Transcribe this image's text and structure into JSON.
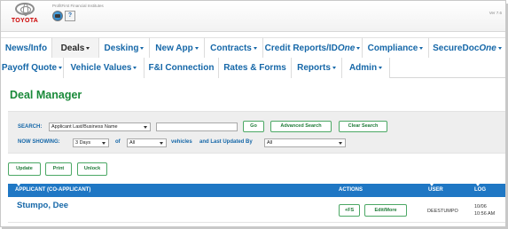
{
  "header": {
    "brand": "TOYOTA",
    "caption": "ProfitFirst Financial Institutes",
    "help_icon": "?",
    "version": "Ver 7.6"
  },
  "nav": {
    "row1": [
      {
        "label": "News/Info",
        "dropdown": false,
        "active": false
      },
      {
        "label": "Deals",
        "dropdown": true,
        "active": true
      },
      {
        "label": "Desking",
        "dropdown": true,
        "active": false
      },
      {
        "label": "New App",
        "dropdown": true,
        "active": false
      },
      {
        "label": "Contracts",
        "dropdown": true,
        "active": false
      },
      {
        "label": "Credit Reports/ID",
        "label_italic": "One",
        "dropdown": true,
        "active": false
      },
      {
        "label": "Compliance",
        "dropdown": true,
        "active": false
      },
      {
        "label": "SecureDoc",
        "label_italic": "One",
        "dropdown": true,
        "active": false
      }
    ],
    "row2": [
      {
        "label": "Payoff Quote",
        "dropdown": true
      },
      {
        "label": "Vehicle Values",
        "dropdown": true
      },
      {
        "label": "F&I Connection",
        "dropdown": false
      },
      {
        "label": "Rates & Forms",
        "dropdown": false
      },
      {
        "label": "Reports",
        "dropdown": true
      },
      {
        "label": "Admin",
        "dropdown": true
      }
    ]
  },
  "page": {
    "title": "Deal Manager"
  },
  "search": {
    "label": "SEARCH:",
    "field_select": "Applicant Last/Business Name",
    "query_value": "",
    "go_button": "Go",
    "advanced_button": "Advanced Search",
    "clear_button": "Clear Search",
    "showing_label": "NOW SHOWING:",
    "days_select": "3 Days",
    "of_label": "of",
    "scope_select": "All",
    "vehicles_label": "vehicles",
    "updated_by_label": "and Last Updated By",
    "updated_by_select": "All"
  },
  "actions": {
    "update": "Update",
    "print": "Print",
    "unlock": "Unlock"
  },
  "table": {
    "columns": {
      "applicant": "APPLICANT (CO-APPLICANT)",
      "actions": "ACTIONS",
      "user": "USER",
      "log": "LOG"
    },
    "rows": [
      {
        "applicant": "Stumpo, Dee",
        "btn_fs": "+FS",
        "btn_edit": "Edit/More",
        "user": "DEESTUMPO",
        "log_date": "10/06",
        "log_time": "10:56 AM"
      }
    ]
  },
  "colors": {
    "link_blue": "#1567a8",
    "accent_green": "#1a8a3a",
    "header_blue": "#1f77c4",
    "brand_red": "#cc0000"
  }
}
